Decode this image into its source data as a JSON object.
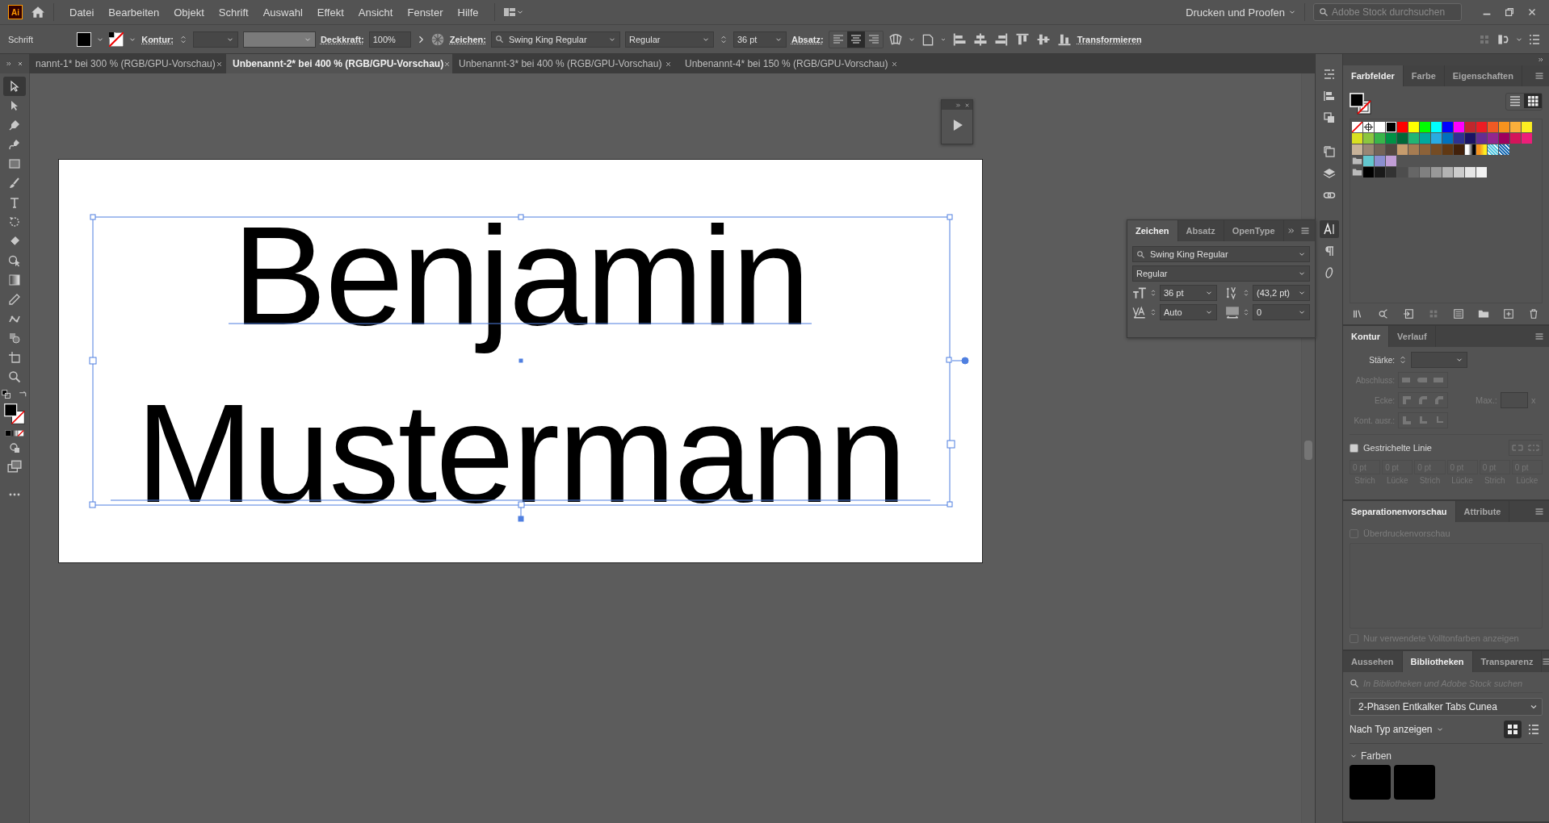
{
  "app_logo": "Ai",
  "menu": [
    "Datei",
    "Bearbeiten",
    "Objekt",
    "Schrift",
    "Auswahl",
    "Effekt",
    "Ansicht",
    "Fenster",
    "Hilfe"
  ],
  "workspace": "Drucken und Proofen",
  "stock_search": {
    "placeholder": "Adobe Stock durchsuchen"
  },
  "control_bar": {
    "object_type": "Schrift",
    "stroke_label": "Kontur:",
    "opacity_label": "Deckkraft:",
    "opacity": "100%",
    "character_label": "Zeichen:",
    "font": "Swing King Regular",
    "style": "Regular",
    "size": "36 pt",
    "paragraph_label": "Absatz:",
    "align": [
      {
        "selected": false
      },
      {
        "selected": true
      },
      {
        "selected": false
      }
    ],
    "transform": "Transformieren"
  },
  "documents": [
    {
      "title": "nannt-1* bei 300 % (RGB/GPU-Vorschau)",
      "selected": false
    },
    {
      "title": "Unbenannt-2* bei 400 % (RGB/GPU-Vorschau)",
      "selected": true
    },
    {
      "title": "Unbenannt-3* bei 400 % (RGB/GPU-Vorschau)",
      "selected": false
    },
    {
      "title": "Unbenannt-4* bei 150 % (RGB/GPU-Vorschau)",
      "selected": false
    }
  ],
  "tools": [
    {
      "selected": true
    },
    {
      "selected": false
    },
    {
      "selected": false
    },
    {
      "selected": false
    },
    {
      "selected": false
    },
    {
      "selected": false
    },
    {
      "selected": false
    },
    {
      "selected": false
    },
    {
      "selected": false
    },
    {
      "selected": false
    },
    {
      "selected": false
    },
    {
      "selected": false
    },
    {
      "selected": false
    },
    {
      "selected": false
    },
    {
      "selected": false
    },
    {
      "selected": false
    }
  ],
  "artboard": {
    "lines": [
      "Benjamin",
      "Mustermann"
    ]
  },
  "character_panel": {
    "tabs": [
      {
        "label": "Zeichen",
        "selected": true
      },
      {
        "label": "Absatz",
        "selected": false
      },
      {
        "label": "OpenType",
        "selected": false
      }
    ],
    "font": "Swing King Regular",
    "style": "Regular",
    "size": "36 pt",
    "leading": "(43,2 pt)",
    "kerning": "Auto",
    "tracking": "0"
  },
  "panel_strip": [
    {
      "selected": false
    },
    {
      "selected": false
    },
    {
      "selected": false
    },
    {
      "selected": false
    },
    {
      "selected": false
    },
    {
      "selected": false
    },
    {
      "selected": true
    },
    {
      "selected": false
    },
    {
      "selected": false
    }
  ],
  "swatches_panel": {
    "tabs": [
      {
        "label": "Farbfelder",
        "selected": true
      },
      {
        "label": "Farbe",
        "selected": false
      },
      {
        "label": "Eigenschaften",
        "selected": false
      }
    ],
    "view": [
      {
        "selected": false
      },
      {
        "selected": true
      }
    ],
    "rows": [
      {
        "folder": false,
        "swatches": [
          {
            "kind": "none"
          },
          {
            "kind": "registration"
          },
          {
            "kind": "color",
            "color": "#ffffff"
          },
          {
            "kind": "color",
            "color": "#000000"
          },
          {
            "kind": "color",
            "color": "#ff0000"
          },
          {
            "kind": "color",
            "color": "#ffff00"
          },
          {
            "kind": "color",
            "color": "#00ff00"
          },
          {
            "kind": "color",
            "color": "#00ffff"
          },
          {
            "kind": "color",
            "color": "#0000ff"
          },
          {
            "kind": "color",
            "color": "#ff00ff"
          },
          {
            "kind": "color",
            "color": "#c1272d"
          },
          {
            "kind": "color",
            "color": "#ed1c24"
          },
          {
            "kind": "color",
            "color": "#f15a24"
          },
          {
            "kind": "color",
            "color": "#f7931e"
          },
          {
            "kind": "color",
            "color": "#fbb03b"
          },
          {
            "kind": "color",
            "color": "#fcee21"
          }
        ]
      },
      {
        "folder": false,
        "swatches": [
          {
            "kind": "color",
            "color": "#d9e021"
          },
          {
            "kind": "color",
            "color": "#8cc63f"
          },
          {
            "kind": "color",
            "color": "#39b54a"
          },
          {
            "kind": "color",
            "color": "#009245"
          },
          {
            "kind": "color",
            "color": "#006837"
          },
          {
            "kind": "color",
            "color": "#22b573"
          },
          {
            "kind": "color",
            "color": "#00a99d"
          },
          {
            "kind": "color",
            "color": "#29abe2"
          },
          {
            "kind": "color",
            "color": "#0071bc"
          },
          {
            "kind": "color",
            "color": "#2e3192"
          },
          {
            "kind": "color",
            "color": "#1b1464"
          },
          {
            "kind": "color",
            "color": "#662d91"
          },
          {
            "kind": "color",
            "color": "#93278f"
          },
          {
            "kind": "color",
            "color": "#9e005d"
          },
          {
            "kind": "color",
            "color": "#d4145a"
          },
          {
            "kind": "color",
            "color": "#ed1e79"
          }
        ]
      },
      {
        "folder": false,
        "swatches": [
          {
            "kind": "color",
            "color": "#c7b299"
          },
          {
            "kind": "color",
            "color": "#998675"
          },
          {
            "kind": "color",
            "color": "#736357"
          },
          {
            "kind": "color",
            "color": "#534741"
          },
          {
            "kind": "color",
            "color": "#c69c6d"
          },
          {
            "kind": "color",
            "color": "#a67c52"
          },
          {
            "kind": "color",
            "color": "#8c6239"
          },
          {
            "kind": "color",
            "color": "#754c24"
          },
          {
            "kind": "color",
            "color": "#603813"
          },
          {
            "kind": "color",
            "color": "#42210b"
          },
          {
            "kind": "gradient",
            "stops": [
              {
                "color": "#ffffff"
              },
              {
                "color": "#000000"
              }
            ]
          },
          {
            "kind": "gradient",
            "stops": [
              {
                "color": "#f7931e"
              },
              {
                "color": "#fcee21"
              }
            ]
          },
          {
            "kind": "pattern",
            "color": "#5ac8e0"
          },
          {
            "kind": "pattern",
            "color": "#1f6fb5"
          }
        ]
      },
      {
        "folder": true,
        "swatches": [
          {
            "kind": "color",
            "color": "#62c6ce"
          },
          {
            "kind": "color",
            "color": "#8b8fd0"
          },
          {
            "kind": "color",
            "color": "#c19ed6"
          }
        ]
      },
      {
        "folder": true,
        "swatches": [
          {
            "kind": "color",
            "color": "#000000"
          },
          {
            "kind": "color",
            "color": "#1a1a1a"
          },
          {
            "kind": "color",
            "color": "#333333"
          },
          {
            "kind": "color",
            "color": "#4d4d4d"
          },
          {
            "kind": "color",
            "color": "#666666"
          },
          {
            "kind": "color",
            "color": "#808080"
          },
          {
            "kind": "color",
            "color": "#999999"
          },
          {
            "kind": "color",
            "color": "#b3b3b3"
          },
          {
            "kind": "color",
            "color": "#cccccc"
          },
          {
            "kind": "color",
            "color": "#e6e6e6"
          },
          {
            "kind": "color",
            "color": "#f2f2f2"
          }
        ]
      }
    ]
  },
  "stroke_panel": {
    "tabs": [
      {
        "label": "Kontur",
        "selected": true
      },
      {
        "label": "Verlauf",
        "selected": false
      }
    ],
    "weight_label": "Stärke:",
    "disabled": true,
    "cap_label": "Abschluss:",
    "corner_label": "Ecke:",
    "limit_label": "Max.:",
    "limit_unit": "x",
    "align_label": "Kont. ausr.:",
    "dashed": {
      "label": "Gestrichelte Linie",
      "mixed": true
    },
    "dash_fields": [
      {
        "value": "0 pt",
        "label": "Strich"
      },
      {
        "value": "0 pt",
        "label": "Lücke"
      },
      {
        "value": "0 pt",
        "label": "Strich"
      },
      {
        "value": "0 pt",
        "label": "Lücke"
      },
      {
        "value": "0 pt",
        "label": "Strich"
      },
      {
        "value": "0 pt",
        "label": "Lücke"
      }
    ]
  },
  "separations_panel": {
    "tabs": [
      {
        "label": "Separationenvorschau",
        "selected": true
      },
      {
        "label": "Attribute",
        "selected": false
      }
    ],
    "overprint": {
      "label": "Überdruckenvorschau",
      "checked": false,
      "disabled": true
    },
    "spot_only": {
      "label": "Nur verwendete Volltonfarben anzeigen",
      "checked": false,
      "disabled": true
    }
  },
  "libraries_panel": {
    "tabs": [
      {
        "label": "Aussehen",
        "selected": false
      },
      {
        "label": "Bibliotheken",
        "selected": true
      },
      {
        "label": "Transparenz",
        "selected": false
      }
    ],
    "search": {
      "placeholder": "In Bibliotheken und Adobe Stock suchen"
    },
    "library": "2-Phasen Entkalker Tabs Cunea",
    "sort": "Nach Typ anzeigen",
    "view": [
      {
        "selected": true
      },
      {
        "selected": false
      }
    ],
    "section": {
      "title": "Farben",
      "expanded": true,
      "colors": [
        {
          "color": "#000000"
        },
        {
          "color": "#000000"
        }
      ]
    }
  }
}
